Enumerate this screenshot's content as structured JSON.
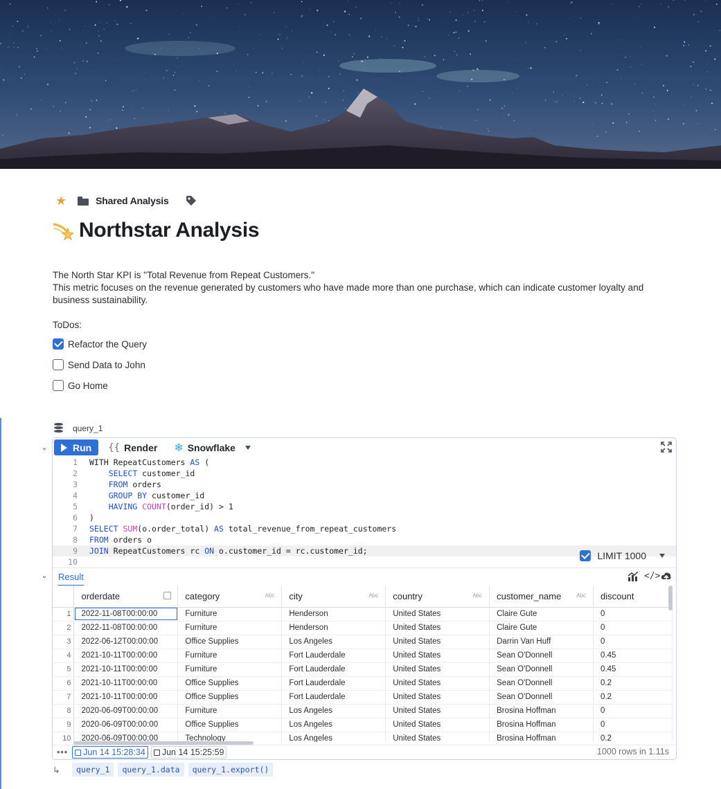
{
  "breadcrumb": {
    "folder_label": "Shared Analysis"
  },
  "page": {
    "title": "Northstar Analysis",
    "description_line1": "The North Star KPI is \"Total Revenue from Repeat Customers.\"",
    "description_line2": "This metric focuses on the revenue generated by customers who have made more than one purchase, which can indicate customer loyalty and business sustainability.",
    "todos_label": "ToDos:",
    "todos": [
      {
        "label": "Refactor the Query",
        "checked": true
      },
      {
        "label": "Send Data to John",
        "checked": false
      },
      {
        "label": "Go Home",
        "checked": false
      }
    ]
  },
  "query": {
    "name": "query_1",
    "toolbar": {
      "run_label": "Run",
      "render_label": "Render",
      "connection_label": "Snowflake"
    },
    "line_numbers": [
      "1",
      "2",
      "3",
      "4",
      "5",
      "6",
      "7",
      "8",
      "9",
      "10"
    ],
    "limit_label": "LIMIT 1000",
    "limit_enabled": true,
    "result_tab_label": "Result",
    "columns": [
      {
        "name": "orderdate",
        "type": "date"
      },
      {
        "name": "category",
        "type": "Abc"
      },
      {
        "name": "city",
        "type": "Abc"
      },
      {
        "name": "country",
        "type": "Abc"
      },
      {
        "name": "customer_name",
        "type": "Abc"
      },
      {
        "name": "discount",
        "type": ""
      }
    ],
    "rows": [
      [
        "1",
        "2022-11-08T00:00:00",
        "Furniture",
        "Henderson",
        "United States",
        "Claire Gute",
        "0"
      ],
      [
        "2",
        "2022-11-08T00:00:00",
        "Furniture",
        "Henderson",
        "United States",
        "Claire Gute",
        "0"
      ],
      [
        "3",
        "2022-06-12T00:00:00",
        "Office Supplies",
        "Los Angeles",
        "United States",
        "Darrin Van Huff",
        "0"
      ],
      [
        "4",
        "2021-10-11T00:00:00",
        "Furniture",
        "Fort Lauderdale",
        "United States",
        "Sean O'Donnell",
        "0.45"
      ],
      [
        "5",
        "2021-10-11T00:00:00",
        "Furniture",
        "Fort Lauderdale",
        "United States",
        "Sean O'Donnell",
        "0.45"
      ],
      [
        "6",
        "2021-10-11T00:00:00",
        "Office Supplies",
        "Fort Lauderdale",
        "United States",
        "Sean O'Donnell",
        "0.2"
      ],
      [
        "7",
        "2021-10-11T00:00:00",
        "Office Supplies",
        "Fort Lauderdale",
        "United States",
        "Sean O'Donnell",
        "0.2"
      ],
      [
        "8",
        "2020-06-09T00:00:00",
        "Furniture",
        "Los Angeles",
        "United States",
        "Brosina Hoffman",
        "0"
      ],
      [
        "9",
        "2020-06-09T00:00:00",
        "Office Supplies",
        "Los Angeles",
        "United States",
        "Brosina Hoffman",
        "0"
      ],
      [
        "10",
        "2020-06-09T00:00:00",
        "Technology",
        "Los Angeles",
        "United States",
        "Brosina Hoffman",
        "0.2"
      ]
    ],
    "footer": {
      "run_timestamp": "Jun 14 15:28:34",
      "prev_timestamp": "Jun 14 15:25:59",
      "rows_info": "1000 rows in 1.11s"
    },
    "outputs": [
      "query_1",
      "query_1.data",
      "query_1.export()"
    ]
  },
  "colors": {
    "accent": "#2f6fd8",
    "keyword": "#1f4fd6",
    "function": "#c542c0",
    "star": "#e5a43a"
  },
  "icons": [
    "star-icon",
    "folder-icon",
    "tag-icon",
    "shooting-star-emoji",
    "database-icon",
    "play-icon",
    "render-braces-icon",
    "snowflake-icon",
    "expand-icon",
    "chart-icon",
    "code-icon",
    "upload-cloud-icon",
    "calendar-icon",
    "return-arrow-icon"
  ]
}
